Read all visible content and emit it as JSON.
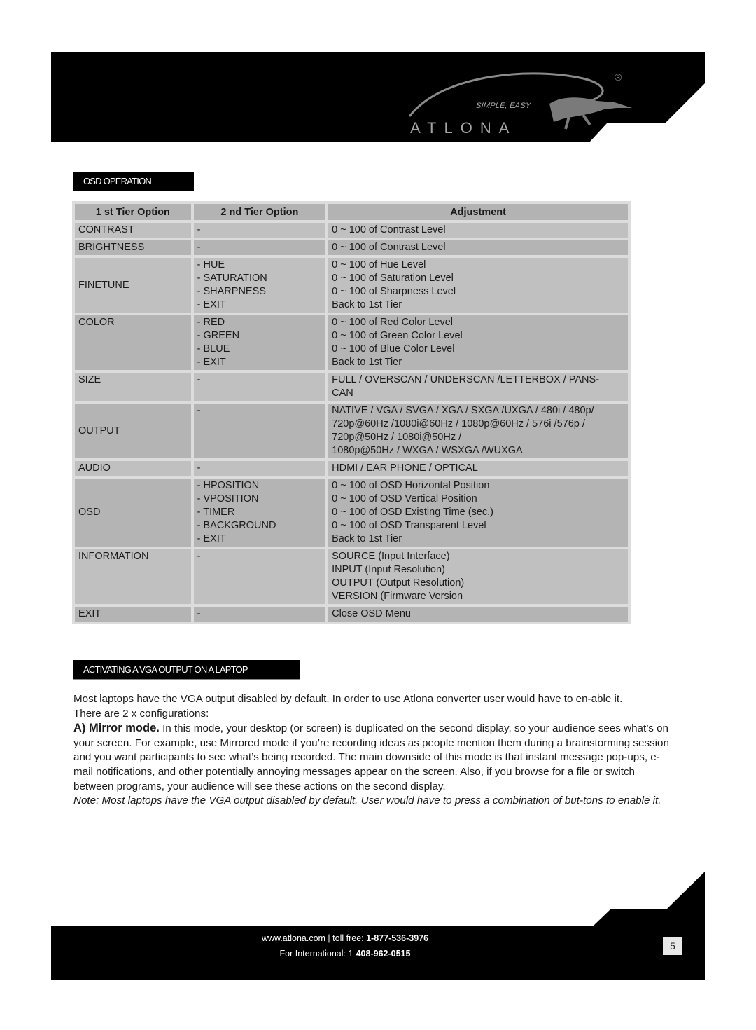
{
  "header": {
    "brand": "ATLONA",
    "tagline": "SIMPLE, EASY",
    "registered_mark": "®",
    "logo_icon": "lizard-logo-icon"
  },
  "sections": {
    "osd_operation": "OSD OPERATION",
    "vga_output": "ACTIVATING A VGA OUTPUT ON A LAPTOP"
  },
  "table": {
    "headers": [
      "1 st Tier Option",
      "2 nd Tier Option",
      "Adjustment"
    ],
    "rows": [
      {
        "tier1": "CONTRAST",
        "tier2": [
          "-"
        ],
        "adjustment": [
          "0 ~ 100 of Contrast Level"
        ]
      },
      {
        "tier1": "BRIGHTNESS",
        "tier2": [
          "-"
        ],
        "adjustment": [
          "0 ~ 100 of Contrast Level"
        ]
      },
      {
        "tier1": "FINETUNE",
        "tier2": [
          "- HUE",
          "- SATURATION",
          "- SHARPNESS",
          "- EXIT"
        ],
        "adjustment": [
          "0 ~ 100 of Hue Level",
          "0 ~ 100 of Saturation Level",
          "0 ~ 100 of Sharpness Level",
          "Back to 1st Tier"
        ]
      },
      {
        "tier1": "COLOR",
        "tier2": [
          "- RED",
          "- GREEN",
          "- BLUE",
          "- EXIT"
        ],
        "adjustment": [
          "0 ~ 100 of Red Color Level",
          "0 ~ 100 of Green Color Level",
          "0 ~ 100 of Blue Color Level",
          "Back to 1st Tier"
        ]
      },
      {
        "tier1": "SIZE",
        "tier2": [
          "-"
        ],
        "adjustment": [
          "FULL / OVERSCAN / UNDERSCAN /LETTERBOX / PANS-",
          "CAN"
        ]
      },
      {
        "tier1": "OUTPUT",
        "tier2": [
          "-"
        ],
        "adjustment": [
          "NATIVE / VGA / SVGA / XGA / SXGA /UXGA / 480i / 480p/",
          "720p@60Hz /1080i@60Hz / 1080p@60Hz / 576i /576p /",
          "720p@50Hz / 1080i@50Hz /",
          "1080p@50Hz / WXGA / WSXGA /WUXGA"
        ]
      },
      {
        "tier1": "AUDIO",
        "tier2": [
          "-"
        ],
        "adjustment": [
          "HDMI / EAR PHONE / OPTICAL"
        ]
      },
      {
        "tier1": "OSD",
        "tier2": [
          "- HPOSITION",
          "- VPOSITION",
          "- TIMER",
          "- BACKGROUND",
          "- EXIT"
        ],
        "adjustment": [
          "0 ~ 100 of OSD Horizontal Position",
          "0 ~ 100 of OSD Vertical Position",
          "0 ~ 100 of OSD Existing Time (sec.)",
          "0 ~ 100 of OSD Transparent Level",
          "Back to 1st Tier"
        ]
      },
      {
        "tier1": "INFORMATION",
        "tier2": [
          "-"
        ],
        "adjustment": [
          "SOURCE (Input Interface)",
          "INPUT (Input Resolution)",
          "OUTPUT (Output Resolution)",
          "VERSION (Firmware Version"
        ]
      },
      {
        "tier1": "EXIT",
        "tier2": [
          "-"
        ],
        "adjustment": [
          "Close OSD Menu"
        ]
      }
    ]
  },
  "body": {
    "intro": "Most laptops have the VGA output disabled by default. In order to use Atlona converter user would have to en-able it.",
    "configs": "There are 2 x configurations:",
    "mirror_title": "A) Mirror mode.",
    "mirror_text": " In this mode, your desktop (or screen) is duplicated on the second display, so your audience sees what’s on your screen. For example, use Mirrored mode if you’re recording ideas as people mention them during a brainstorming session and you want participants to see what’s being recorded. The main downside of this mode is that instant message pop-ups, e-mail notifications, and other potentially annoying messages appear on the screen.  Also, if you browse for a file or switch between programs, your audience will see these actions on the second display.",
    "note": "Note: Most laptops have the VGA output disabled by default. User would have to press a combination of but-tons to enable it."
  },
  "footer": {
    "website": "www.atlona.com",
    "separator": " | ",
    "toll_free_label": "toll free: ",
    "toll_free_number": "1-877-536-3976",
    "intl_label": "For International: 1-",
    "intl_number": "408-962-0515",
    "page_number": "5"
  }
}
